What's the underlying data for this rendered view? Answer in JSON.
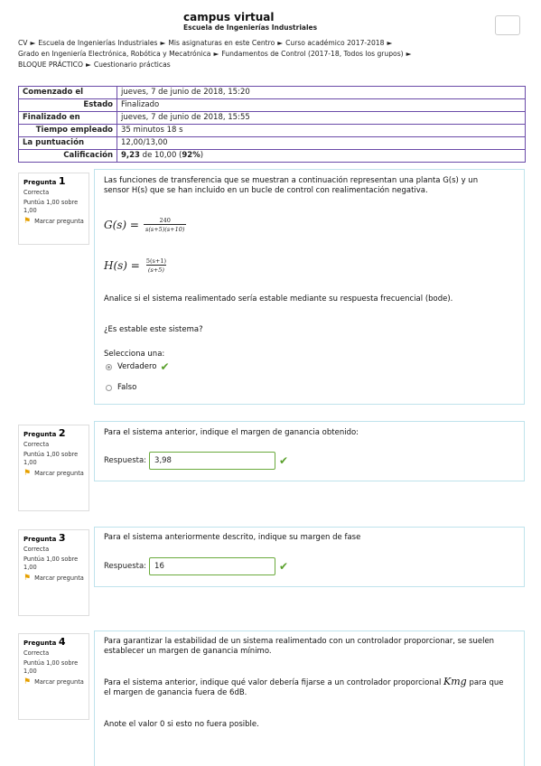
{
  "header": {
    "site_name": "campus virtual",
    "site_sub": "Escuela de Ingenierías Industriales"
  },
  "breadcrumb": {
    "line1": [
      "CV",
      "Escuela de Ingenierías Industriales",
      "Mis asignaturas en este Centro",
      "Curso académico 2017-2018"
    ],
    "line2": [
      "Grado en Ingeniería Electrónica, Robótica y Mecatrónica",
      "Fundamentos de Control (2017-18, Todos los grupos)"
    ],
    "line3": [
      "BLOQUE PRÁCTICO",
      "Cuestionario prácticas"
    ],
    "separator": "►"
  },
  "summary": {
    "comenzado_label": "Comenzado el",
    "comenzado_value": "jueves, 7 de junio de 2018, 15:20",
    "estado_label": "Estado",
    "estado_value": "Finalizado",
    "finalizado_label": "Finalizado en",
    "finalizado_value": "jueves, 7 de junio de 2018, 15:55",
    "tiempo_label": "Tiempo empleado",
    "tiempo_value": "35 minutos 18 s",
    "puntuacion_label": "La puntuación",
    "puntuacion_value": "12,00/13,00",
    "calificacion_label": "Calificación",
    "calificacion_grade": "9,23",
    "calificacion_mid": " de 10,00 (",
    "calificacion_pct": "92%",
    "calificacion_end": ")"
  },
  "questions": [
    {
      "prefix": "Pregunta",
      "number": "1",
      "state": "Correcta",
      "grade": "Puntúa 1,00 sobre 1,00",
      "flag": "Marcar pregunta",
      "text1": "Las funciones de transferencia que se muestran a continuación representan una planta G(s) y un sensor H(s) que se han incluido en un bucle de control con realimentación negativa.",
      "g_lhs": "G(s) =",
      "g_num": "240",
      "g_den": "s(s+5)(s+10)",
      "h_lhs": "H(s) =",
      "h_num": "5(s+1)",
      "h_den": "(s+5)",
      "text2": "Analice si el sistema realimentado sería estable mediante su respuesta frecuencial (bode).",
      "text3": "¿Es estable este sistema?",
      "select_label": "Selecciona una:",
      "options": [
        "Verdadero",
        "Falso"
      ]
    },
    {
      "prefix": "Pregunta",
      "number": "2",
      "state": "Correcta",
      "grade": "Puntúa 1,00 sobre 1,00",
      "flag": "Marcar pregunta",
      "text1": "Para el sistema anterior, indique el margen de ganancia obtenido:",
      "answer_label": "Respuesta:",
      "answer_value": "3,98"
    },
    {
      "prefix": "Pregunta",
      "number": "3",
      "state": "Correcta",
      "grade": "Puntúa 1,00 sobre 1,00",
      "flag": "Marcar pregunta",
      "text1": "Para el sistema anteriormente descrito, indique su margen de fase",
      "answer_label": "Respuesta:",
      "answer_value": "16"
    },
    {
      "prefix": "Pregunta",
      "number": "4",
      "state": "Correcta",
      "grade": "Puntúa 1,00 sobre 1,00",
      "flag": "Marcar pregunta",
      "text1": "Para garantizar la estabilidad de un sistema realimentado con un controlador proporcionar, se suelen establecer un margen de ganancia mínimo.",
      "text2a": "Para el sistema anterior, indique qué valor debería fijarse a un controlador proporcional",
      "kmg": "Kmg",
      "text2b": "para que el margen de ganancia fuera de 6dB.",
      "text3": "Anote el valor 0 si esto no fuera posible."
    }
  ],
  "icons": {
    "flag": "flag-icon",
    "check": "check-icon"
  },
  "colors": {
    "summary_border": "#6a4aa8",
    "content_border": "#bfe3ec",
    "correct": "#5aa02c",
    "flag": "#e6a000"
  }
}
